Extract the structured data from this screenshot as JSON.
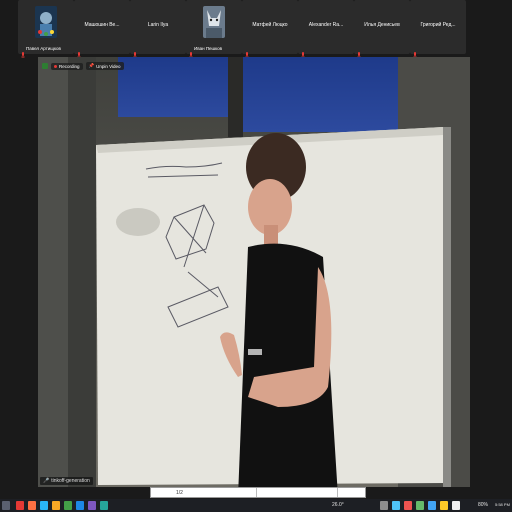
{
  "participants": [
    {
      "name": "Павел Артищков",
      "kind": "avatar"
    },
    {
      "name": "Машошин Ве...",
      "kind": "name"
    },
    {
      "name": "Larin Ilya",
      "kind": "name"
    },
    {
      "name": "Иван Пешков",
      "kind": "avatar"
    },
    {
      "name": "Матфей Люцко",
      "kind": "name"
    },
    {
      "name": "Alexander Ra...",
      "kind": "name"
    },
    {
      "name": "Илья Денисьев",
      "kind": "name"
    },
    {
      "name": "Григорий Ред...",
      "kind": "name"
    }
  ],
  "video": {
    "recording_label": "Recording",
    "unpin_label": "Unpin Video",
    "speaker_name": "tinkoff-generation"
  },
  "taskbar": {
    "progress_text": "1/2",
    "temperature": "26.0°",
    "battery": "80%",
    "time": "5:58 PM"
  },
  "colors": {
    "whiteboard": "#e6e5de",
    "shirt": "#111111",
    "skin": "#d8a38c",
    "window_blue": "#2a4aa0"
  }
}
